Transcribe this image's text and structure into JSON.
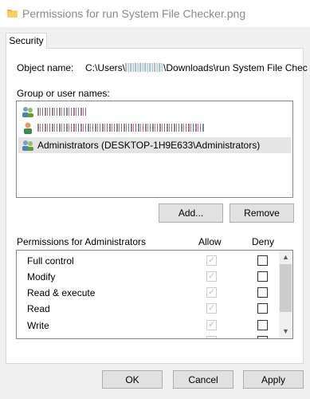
{
  "window": {
    "title": "Permissions for run System File Checker.png"
  },
  "tabs": [
    {
      "label": "Security"
    }
  ],
  "object": {
    "label": "Object name:",
    "value_prefix": "C:\\Users\\",
    "value_suffix": "\\Downloads\\run System File Chec"
  },
  "group_label": "Group or user names:",
  "users": [
    {
      "name": ""
    },
    {
      "name": ""
    },
    {
      "name": "Administrators (DESKTOP-1H9E633\\Administrators)"
    }
  ],
  "buttons": {
    "add": "Add...",
    "remove": "Remove",
    "ok": "OK",
    "cancel": "Cancel",
    "apply": "Apply"
  },
  "permissions": {
    "header": "Permissions for Administrators",
    "allow_header": "Allow",
    "deny_header": "Deny",
    "rows": [
      {
        "name": "Full control",
        "allow": true,
        "deny": false
      },
      {
        "name": "Modify",
        "allow": true,
        "deny": false
      },
      {
        "name": "Read & execute",
        "allow": true,
        "deny": false
      },
      {
        "name": "Read",
        "allow": true,
        "deny": false
      },
      {
        "name": "Write",
        "allow": true,
        "deny": false
      }
    ]
  },
  "colors": {
    "selection": "#e5e5e5",
    "folder": "#e8b84a",
    "button": "#e1e1e1"
  }
}
